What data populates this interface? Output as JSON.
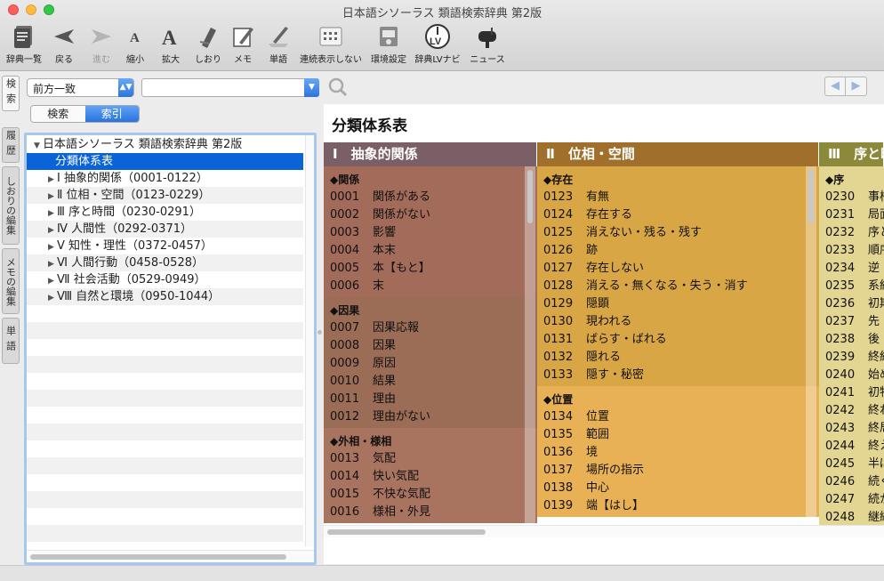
{
  "window": {
    "title": "日本語シソーラス 類語検索辞典 第2版"
  },
  "toolbar": {
    "items": [
      {
        "label": "辞典一覧",
        "icon": "book-stack-icon",
        "enabled": true
      },
      {
        "label": "戻る",
        "icon": "back-arrow-icon",
        "enabled": true
      },
      {
        "label": "進む",
        "icon": "forward-arrow-icon",
        "enabled": false
      },
      {
        "label": "縮小",
        "icon": "font-decrease-icon",
        "enabled": true
      },
      {
        "label": "拡大",
        "icon": "font-increase-icon",
        "enabled": true
      },
      {
        "label": "しおり",
        "icon": "bookmark-pen-icon",
        "enabled": true
      },
      {
        "label": "メモ",
        "icon": "memo-pencil-icon",
        "enabled": true
      },
      {
        "label": "単語",
        "icon": "word-pen-icon",
        "enabled": true
      },
      {
        "label": "連続表示しない",
        "icon": "continuous-display-icon",
        "enabled": true
      },
      {
        "label": "環境設定",
        "icon": "preferences-icon",
        "enabled": true
      },
      {
        "label": "辞典LVナビ",
        "icon": "lv-navi-icon",
        "enabled": true
      },
      {
        "label": "ニュース",
        "icon": "mailbox-icon",
        "enabled": true
      }
    ]
  },
  "side_tabs": [
    {
      "label": "検索"
    },
    {
      "label": "索引"
    },
    {
      "label": "履歴"
    },
    {
      "label": "しおりの編集"
    },
    {
      "label": "メモの編集"
    },
    {
      "label": "単語"
    }
  ],
  "search": {
    "mode_value": "前方一致",
    "query_value": "",
    "segment_search": "検索",
    "segment_index": "索引"
  },
  "tree": {
    "root": "日本語シソーラス 類語検索辞典 第2版",
    "selected": "分類体系表",
    "items": [
      "Ⅰ 抽象的関係（0001-0122）",
      "Ⅱ 位相・空間（0123-0229）",
      "Ⅲ 序と時間（0230-0291）",
      "Ⅳ 人間性（0292-0371）",
      "Ⅴ 知性・理性（0372-0457）",
      "Ⅵ 人間行動（0458-0528）",
      "Ⅶ 社会活動（0529-0949）",
      "Ⅷ 自然と環境（0950-1044）"
    ]
  },
  "content": {
    "title": "分類体系表",
    "columns": [
      {
        "heading": "Ⅰ　抽象的関係",
        "head_color": "#7b5f66",
        "sections": [
          {
            "name": "◆関係",
            "color": "#a36b5a",
            "entries": [
              {
                "code": "0001",
                "label": "関係がある"
              },
              {
                "code": "0002",
                "label": "関係がない"
              },
              {
                "code": "0003",
                "label": "影響"
              },
              {
                "code": "0004",
                "label": "本末"
              },
              {
                "code": "0005",
                "label": "本【もと】"
              },
              {
                "code": "0006",
                "label": "末"
              }
            ]
          },
          {
            "name": "◆因果",
            "color": "#9b6c56",
            "entries": [
              {
                "code": "0007",
                "label": "因果応報"
              },
              {
                "code": "0008",
                "label": "因果"
              },
              {
                "code": "0009",
                "label": "原因"
              },
              {
                "code": "0010",
                "label": "結果"
              },
              {
                "code": "0011",
                "label": "理由"
              },
              {
                "code": "0012",
                "label": "理由がない"
              }
            ]
          },
          {
            "name": "◆外相・様相",
            "color": "#a8735f",
            "entries": [
              {
                "code": "0013",
                "label": "気配"
              },
              {
                "code": "0014",
                "label": "快い気配"
              },
              {
                "code": "0015",
                "label": "不快な気配"
              },
              {
                "code": "0016",
                "label": "様相・外見"
              }
            ]
          }
        ]
      },
      {
        "heading": "Ⅱ　位相・空間",
        "head_color": "#a06f2b",
        "sections": [
          {
            "name": "◆存在",
            "color": "#d9a645",
            "entries": [
              {
                "code": "0123",
                "label": "有無"
              },
              {
                "code": "0124",
                "label": "存在する"
              },
              {
                "code": "0125",
                "label": "消えない・残る・残す"
              },
              {
                "code": "0126",
                "label": "跡"
              },
              {
                "code": "0127",
                "label": "存在しない"
              },
              {
                "code": "0128",
                "label": "消える・無くなる・失う・消す"
              },
              {
                "code": "0129",
                "label": "隠顕"
              },
              {
                "code": "0130",
                "label": "現われる"
              },
              {
                "code": "0131",
                "label": "ばらす・ばれる"
              },
              {
                "code": "0132",
                "label": "隠れる"
              },
              {
                "code": "0133",
                "label": "隠す・秘密"
              }
            ]
          },
          {
            "name": "◆位置",
            "color": "#e8b155",
            "entries": [
              {
                "code": "0134",
                "label": "位置"
              },
              {
                "code": "0135",
                "label": "範囲"
              },
              {
                "code": "0136",
                "label": "境"
              },
              {
                "code": "0137",
                "label": "場所の指示"
              },
              {
                "code": "0138",
                "label": "中心"
              },
              {
                "code": "0139",
                "label": "端【はし】"
              }
            ]
          }
        ]
      },
      {
        "heading": "Ⅲ　序と時間",
        "head_color": "#8c8a3a",
        "sections": [
          {
            "name": "◆序",
            "color": "#e3d592",
            "entries": [
              {
                "code": "0230",
                "label": "事柄"
              },
              {
                "code": "0231",
                "label": "局面"
              },
              {
                "code": "0232",
                "label": "序と"
              },
              {
                "code": "0233",
                "label": "順序"
              },
              {
                "code": "0234",
                "label": "逆"
              },
              {
                "code": "0235",
                "label": "系統"
              },
              {
                "code": "0236",
                "label": "初期"
              },
              {
                "code": "0237",
                "label": "先"
              },
              {
                "code": "0238",
                "label": "後"
              },
              {
                "code": "0239",
                "label": "終結"
              },
              {
                "code": "0240",
                "label": "始め"
              },
              {
                "code": "0241",
                "label": "初物"
              },
              {
                "code": "0242",
                "label": "終わ"
              },
              {
                "code": "0243",
                "label": "終局"
              },
              {
                "code": "0244",
                "label": "終え"
              },
              {
                "code": "0245",
                "label": "半ば"
              },
              {
                "code": "0246",
                "label": "続く"
              },
              {
                "code": "0247",
                "label": "続か"
              },
              {
                "code": "0248",
                "label": "継続"
              }
            ]
          }
        ]
      }
    ]
  }
}
